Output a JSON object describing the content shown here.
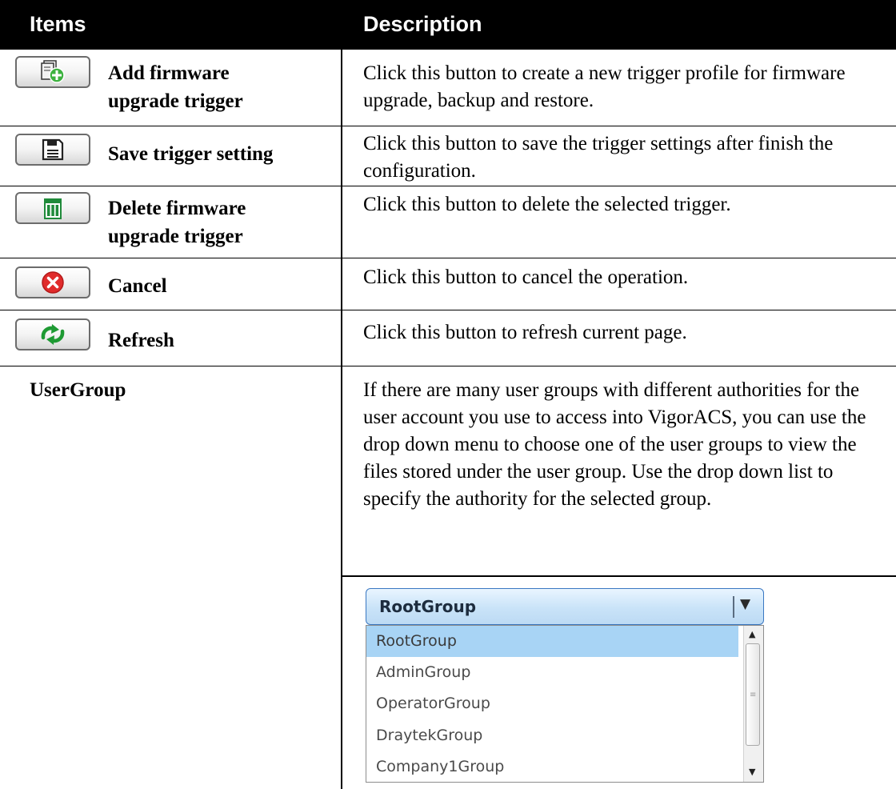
{
  "header": {
    "col_items": "Items",
    "col_description": "Description"
  },
  "rows": [
    {
      "icon": "add-file-icon",
      "label": "Add firmware upgrade trigger",
      "line1": "Add firmware",
      "line2": "upgrade trigger",
      "description": "Click this button to create a new trigger profile for firmware upgrade, backup and restore."
    },
    {
      "icon": "save-icon",
      "label": "Save trigger setting",
      "description": "Click this button to save the trigger settings after finish the configuration."
    },
    {
      "icon": "trash-icon",
      "label": "Delete firmware upgrade trigger",
      "line1": "Delete firmware",
      "line2": "upgrade trigger",
      "description": "Click this button to delete the selected trigger."
    },
    {
      "icon": "cancel-icon",
      "label": "Cancel",
      "description": "Click this button to cancel the operation."
    },
    {
      "icon": "refresh-icon",
      "label": "Refresh",
      "description": "Click this button to refresh current page."
    },
    {
      "label": "UserGroup",
      "description": "If there are many user groups with different authorities for the user account you use to access into VigorACS, you can use the drop down menu to choose one of the user groups to view the files stored under the user group. Use the drop down list to specify the authority for the selected group."
    }
  ],
  "dropdown": {
    "selected": "RootGroup",
    "options": [
      "RootGroup",
      "AdminGroup",
      "OperatorGroup",
      "DraytekGroup",
      "Company1Group"
    ],
    "highlighted_index": 0
  },
  "colors": {
    "header_bg": "#000000",
    "option_highlight": "#a8d4f5",
    "select_border": "#3a78c2"
  }
}
